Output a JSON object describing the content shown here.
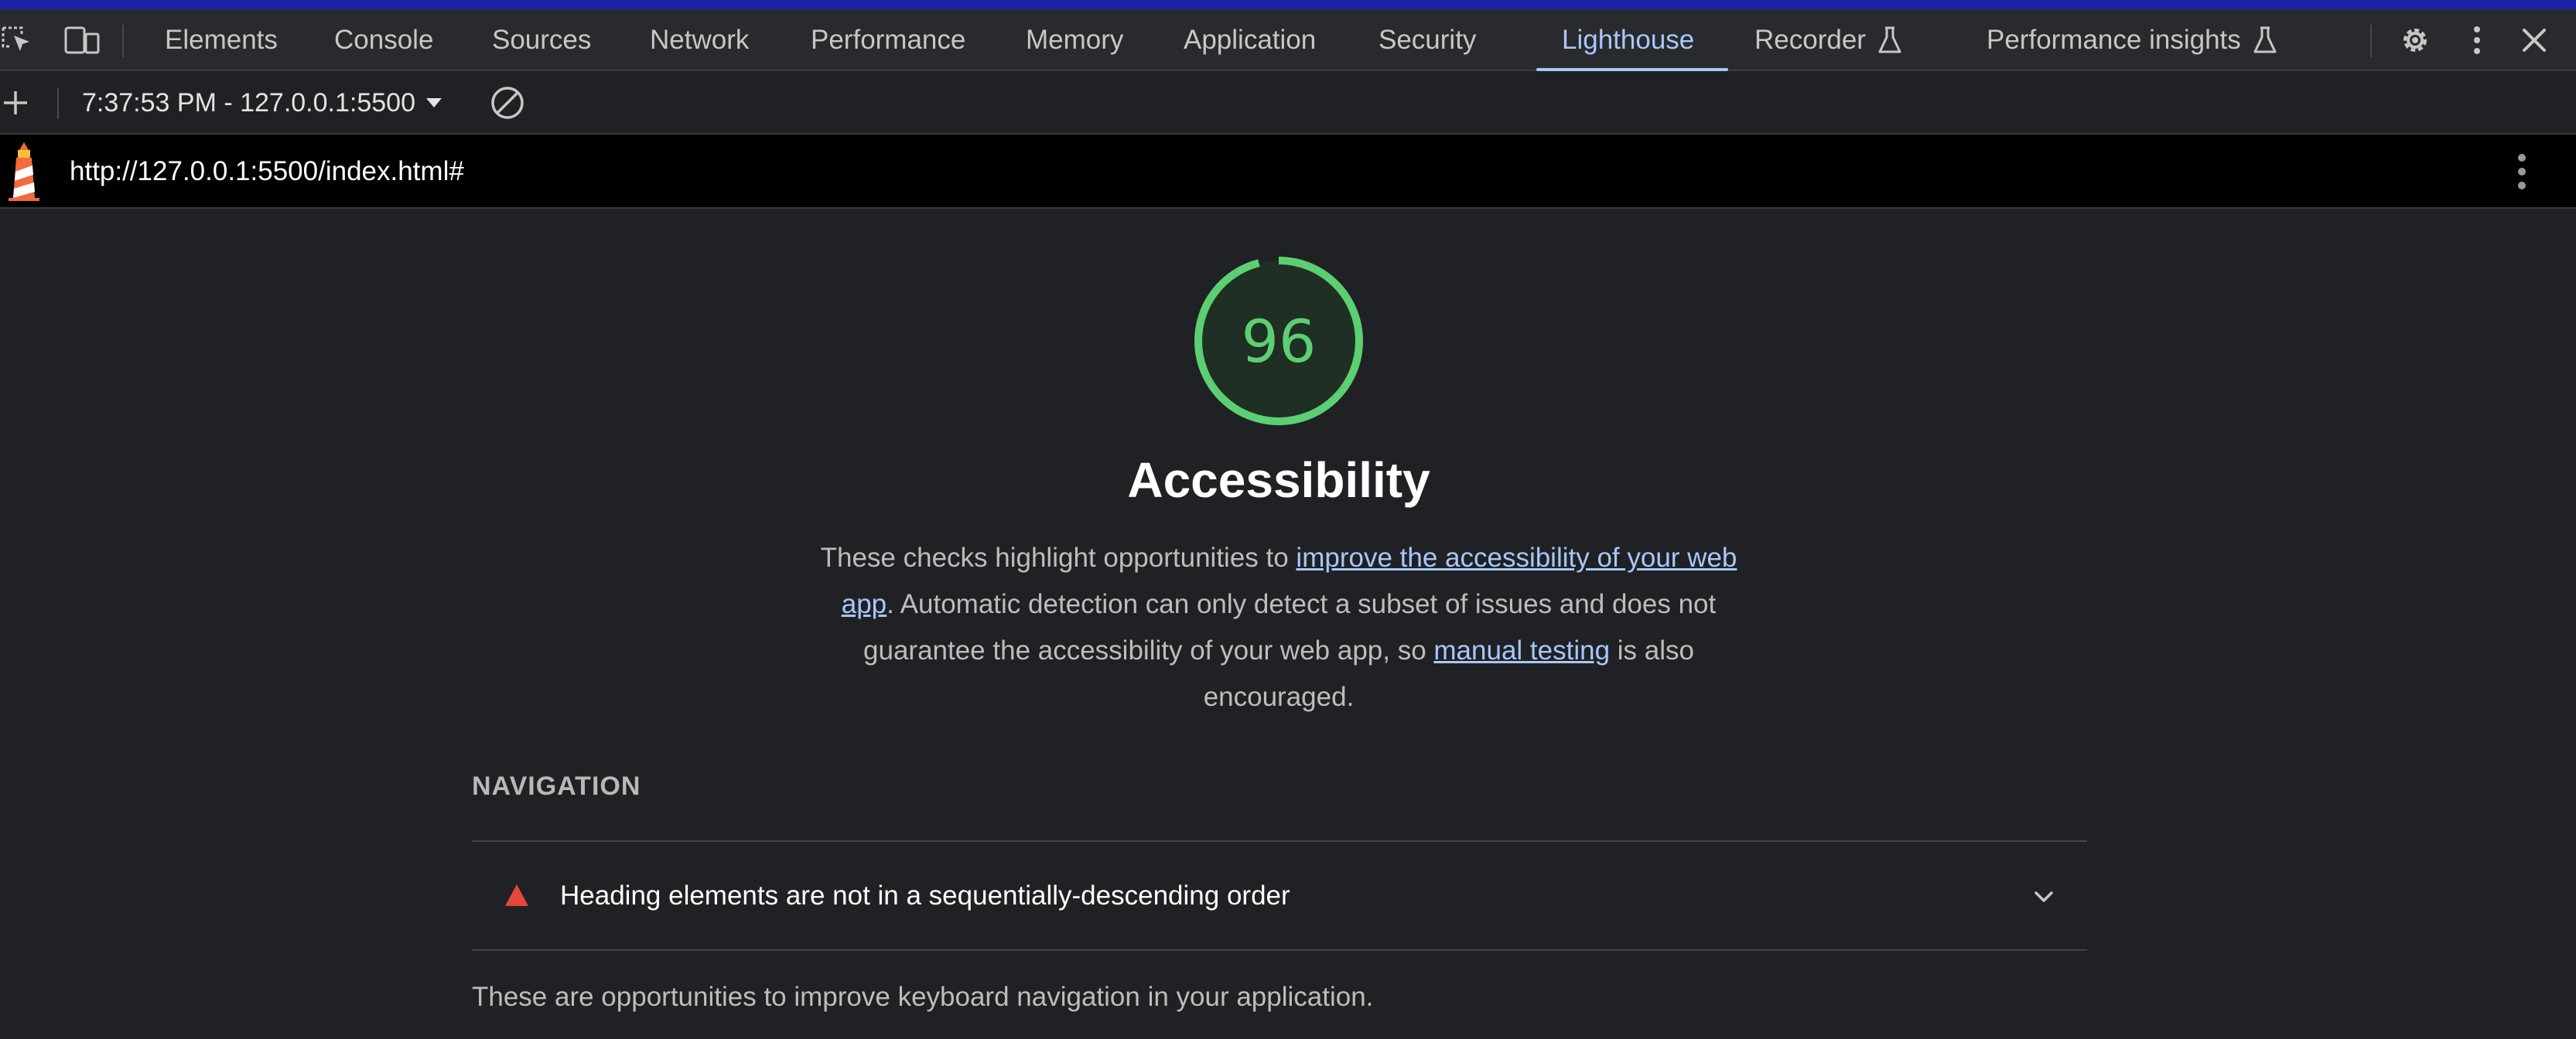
{
  "devtools": {
    "tabs": [
      {
        "label": "Elements"
      },
      {
        "label": "Console"
      },
      {
        "label": "Sources"
      },
      {
        "label": "Network"
      },
      {
        "label": "Performance"
      },
      {
        "label": "Memory"
      },
      {
        "label": "Application"
      },
      {
        "label": "Security"
      },
      {
        "label": "Lighthouse",
        "active": true
      },
      {
        "label": "Recorder",
        "experimental": true
      },
      {
        "label": "Performance insights",
        "experimental": true
      }
    ],
    "icons": [
      "inspect-element-icon",
      "device-toolbar-icon",
      "settings-gear-icon",
      "more-options-icon",
      "close-icon"
    ]
  },
  "report_bar": {
    "report_selector": "7:37:53 PM - 127.0.0.1:5500",
    "icons": [
      "add-report-icon",
      "dropdown-arrow-icon",
      "clear-icon"
    ]
  },
  "url_bar": {
    "url": "http://127.0.0.1:5500/index.html#",
    "icons": [
      "lighthouse-logo-icon",
      "more-vertical-icon"
    ]
  },
  "category": {
    "score": "96",
    "score_fraction": 0.96,
    "score_color": "#5ccf73",
    "title": "Accessibility",
    "desc_part1": "These checks highlight opportunities to ",
    "desc_link1": "improve the accessibility of your web app",
    "desc_part2": ". Automatic detection can only detect a subset of issues and does not guarantee the accessibility of your web app, so ",
    "desc_link2": "manual testing",
    "desc_part3": " is also encouraged."
  },
  "group": {
    "title": "NAVIGATION",
    "audits": [
      {
        "title": "Heading elements are not in a sequentially-descending order",
        "status": "fail",
        "status_color": "#e8453c"
      }
    ],
    "description": "These are opportunities to improve keyboard navigation in your application."
  }
}
